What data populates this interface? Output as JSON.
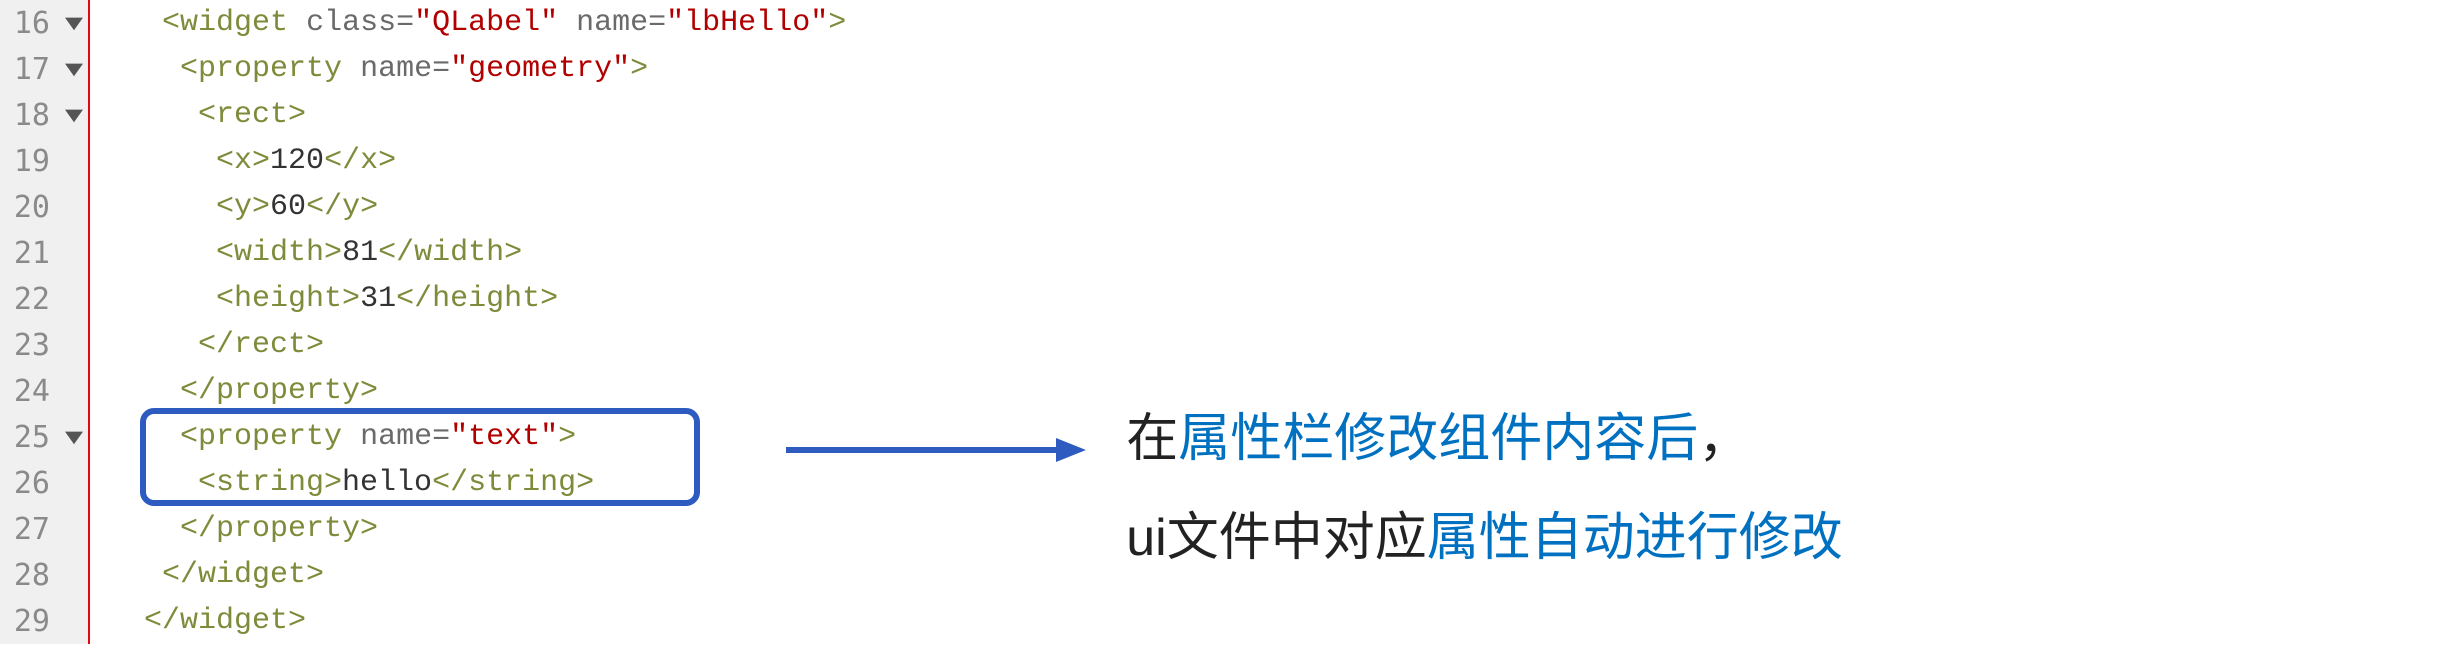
{
  "lines": [
    {
      "num": "16",
      "fold": true
    },
    {
      "num": "17",
      "fold": true
    },
    {
      "num": "18",
      "fold": true
    },
    {
      "num": "19",
      "fold": false
    },
    {
      "num": "20",
      "fold": false
    },
    {
      "num": "21",
      "fold": false
    },
    {
      "num": "22",
      "fold": false
    },
    {
      "num": "23",
      "fold": false
    },
    {
      "num": "24",
      "fold": false
    },
    {
      "num": "25",
      "fold": true
    },
    {
      "num": "26",
      "fold": false
    },
    {
      "num": "27",
      "fold": false
    },
    {
      "num": "28",
      "fold": false
    },
    {
      "num": "29",
      "fold": false
    }
  ],
  "code": {
    "indent": {
      "l16": "   ",
      "l17": "    ",
      "l18": "     ",
      "l19": "      ",
      "l20": "      ",
      "l21": "      ",
      "l22": "      ",
      "l23": "     ",
      "l24": "    ",
      "l25": "    ",
      "l26": "     ",
      "l27": "    ",
      "l28": "   ",
      "l29": "  "
    },
    "l16": {
      "open": "<widget",
      "sp1": " ",
      "a1": "class",
      "eq1": "=",
      "v1": "\"QLabel\"",
      "sp2": " ",
      "a2": "name",
      "eq2": "=",
      "v2": "\"lbHello\"",
      "close": ">"
    },
    "l17": {
      "open": "<property",
      "sp1": " ",
      "a1": "name",
      "eq1": "=",
      "v1": "\"geometry\"",
      "close": ">"
    },
    "l18": {
      "tag": "<rect>"
    },
    "l19": {
      "open": "<x>",
      "val": "120",
      "close": "</x>"
    },
    "l20": {
      "open": "<y>",
      "val": "60",
      "close": "</y>"
    },
    "l21": {
      "open": "<width>",
      "val": "81",
      "close": "</width>"
    },
    "l22": {
      "open": "<height>",
      "val": "31",
      "close": "</height>"
    },
    "l23": {
      "tag": "</rect>"
    },
    "l24": {
      "tag": "</property>"
    },
    "l25": {
      "open": "<property",
      "sp1": " ",
      "a1": "name",
      "eq1": "=",
      "v1": "\"text\"",
      "close": ">"
    },
    "l26": {
      "open": "<string>",
      "val": "hello",
      "close": "</string>"
    },
    "l27": {
      "tag": "</property>"
    },
    "l28": {
      "tag": "</widget>"
    },
    "l29": {
      "tag": "</widget>"
    }
  },
  "annotation": {
    "p1a": "在",
    "p1b": "属性栏修改组件内容后",
    "p1c": "，",
    "p2a": "ui文件中对应",
    "p2b": "属性自动进行修改"
  }
}
